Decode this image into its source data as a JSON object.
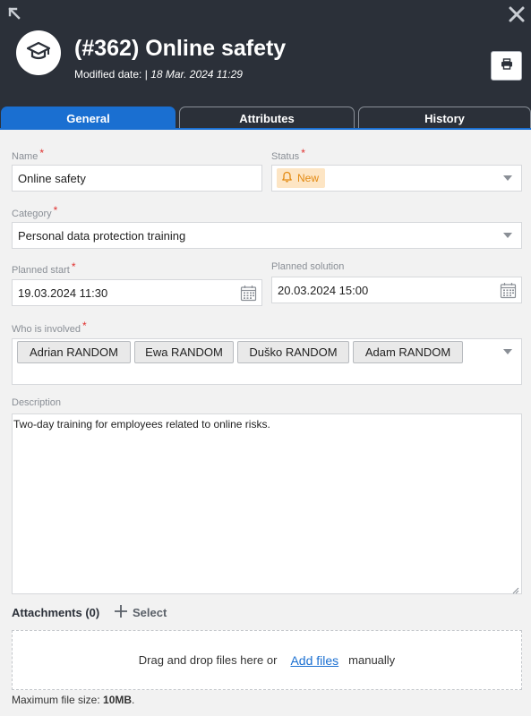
{
  "header": {
    "title": "(#362) Online safety",
    "modified_label": "Modified date:",
    "modified_sep": "|",
    "modified_value": "18 Mar. 2024 11:29"
  },
  "tabs": [
    {
      "label": "General",
      "active": true
    },
    {
      "label": "Attributes",
      "active": false
    },
    {
      "label": "History",
      "active": false
    }
  ],
  "form": {
    "name": {
      "label": "Name",
      "required": "*",
      "value": "Online safety"
    },
    "status": {
      "label": "Status",
      "required": "*",
      "value": "New"
    },
    "category": {
      "label": "Category",
      "required": "*",
      "value": "Personal data protection training"
    },
    "planned_start": {
      "label": "Planned start",
      "required": "*",
      "value": "19.03.2024 11:30"
    },
    "planned_solution": {
      "label": "Planned solution",
      "value": "20.03.2024 15:00"
    },
    "involved": {
      "label": "Who is involved",
      "required": "*",
      "people": [
        "Adrian RANDOM",
        "Ewa RANDOM",
        "Duško RANDOM",
        "Adam RANDOM"
      ]
    },
    "description": {
      "label": "Description",
      "value": "Two-day training for employees related to online risks."
    }
  },
  "attachments": {
    "title": "Attachments (0)",
    "select_label": "Select",
    "drop_text": "Drag and drop files here or",
    "add_files": "Add files",
    "manually": "manually",
    "max_label": "Maximum file size:",
    "max_value": "10MB",
    "max_suffix": "."
  },
  "icons": {
    "collapse": "collapse-arrow-icon",
    "close": "close-icon",
    "avatar": "graduation-cap-icon",
    "print": "printer-icon",
    "status": "bell-icon",
    "calendar": "calendar-icon",
    "add": "plus-icon"
  },
  "colors": {
    "header_bg": "#2b3039",
    "accent": "#1a6fd1",
    "status_bg": "#fde5c4",
    "status_fg": "#e38a12",
    "required": "#e0312f"
  }
}
